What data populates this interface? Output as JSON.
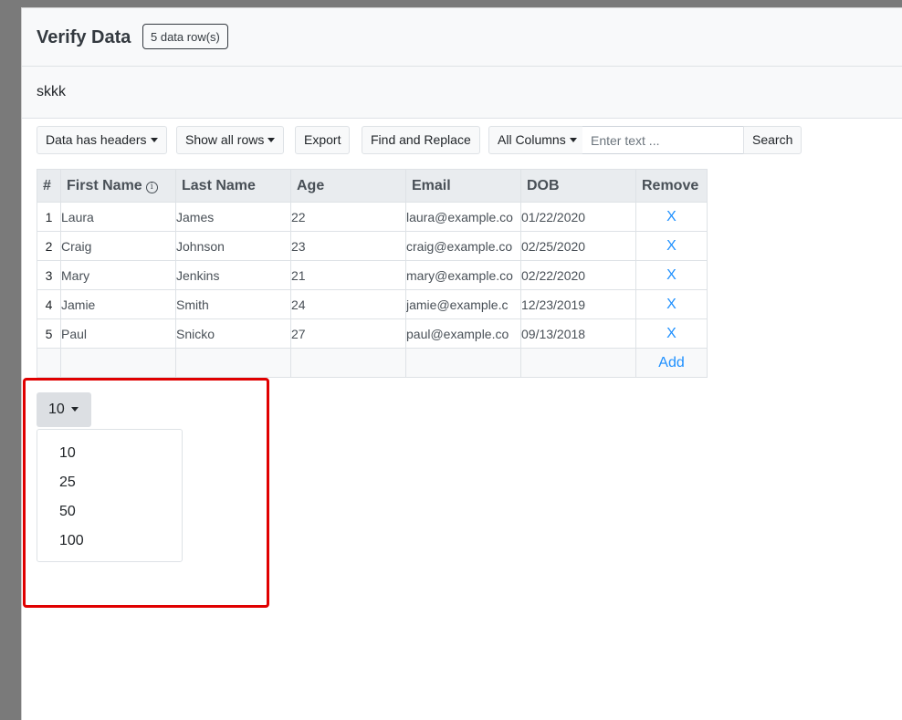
{
  "header": {
    "title": "Verify Data",
    "rows_badge": "5 data row(s)",
    "subtitle": "skkk"
  },
  "toolbar": {
    "headers_dropdown": "Data has headers",
    "rows_dropdown": "Show all rows",
    "export": "Export",
    "find_replace": "Find and Replace",
    "columns_dropdown": "All Columns",
    "search_placeholder": "Enter text ...",
    "search_button": "Search"
  },
  "table": {
    "headers": [
      "#",
      "First Name",
      "Last Name",
      "Age",
      "Email",
      "DOB",
      "Remove"
    ],
    "rows": [
      {
        "num": "1",
        "first": "Laura",
        "last": "James",
        "age": "22",
        "email": "laura@example.co",
        "dob": "01/22/2020",
        "remove": "X"
      },
      {
        "num": "2",
        "first": "Craig",
        "last": "Johnson",
        "age": "23",
        "email": "craig@example.co",
        "dob": "02/25/2020",
        "remove": "X"
      },
      {
        "num": "3",
        "first": "Mary",
        "last": "Jenkins",
        "age": "21",
        "email": "mary@example.co",
        "dob": "02/22/2020",
        "remove": "X"
      },
      {
        "num": "4",
        "first": "Jamie",
        "last": "Smith",
        "age": "24",
        "email": "jamie@example.c",
        "dob": "12/23/2019",
        "remove": "X"
      },
      {
        "num": "5",
        "first": "Paul",
        "last": "Snicko",
        "age": "27",
        "email": "paul@example.co",
        "dob": "09/13/2018",
        "remove": "X"
      }
    ],
    "add_label": "Add",
    "info_icon": "info-circle-icon"
  },
  "pagination": {
    "selected": "10",
    "options": [
      "10",
      "25",
      "50",
      "100"
    ]
  },
  "colors": {
    "link": "#1e90ff",
    "highlight": "#e00000"
  }
}
